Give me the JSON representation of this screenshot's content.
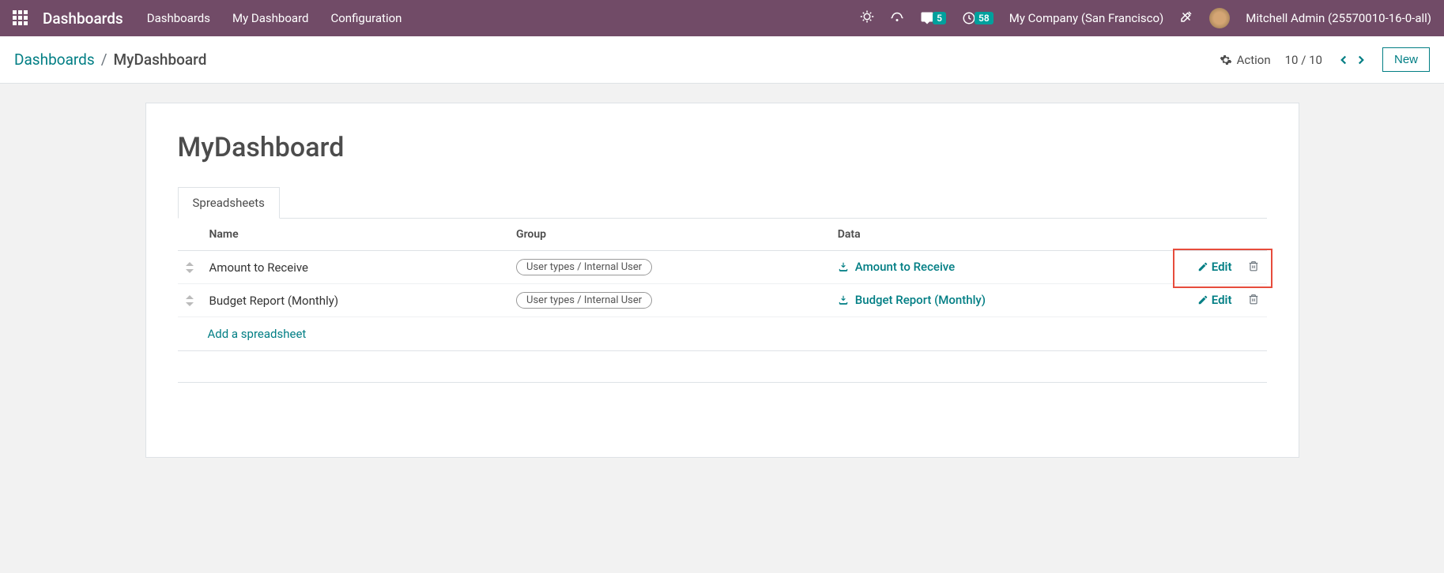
{
  "topnav": {
    "brand": "Dashboards",
    "links": [
      "Dashboards",
      "My Dashboard",
      "Configuration"
    ],
    "chat_badge": "5",
    "clock_badge": "58",
    "company": "My Company (San Francisco)",
    "user": "Mitchell Admin (25570010-16-0-all)"
  },
  "breadcrumb": {
    "root": "Dashboards",
    "current": "MyDashboard"
  },
  "controls": {
    "action_label": "Action",
    "pager": "10 / 10",
    "new_label": "New"
  },
  "sheet": {
    "title": "MyDashboard",
    "tab_label": "Spreadsheets",
    "columns": {
      "name": "Name",
      "group": "Group",
      "data": "Data"
    },
    "rows": [
      {
        "name": "Amount to Receive",
        "group": "User types / Internal User",
        "data": "Amount to Receive",
        "edit": "Edit"
      },
      {
        "name": "Budget Report (Monthly)",
        "group": "User types / Internal User",
        "data": "Budget Report (Monthly)",
        "edit": "Edit"
      }
    ],
    "add_label": "Add a spreadsheet"
  }
}
